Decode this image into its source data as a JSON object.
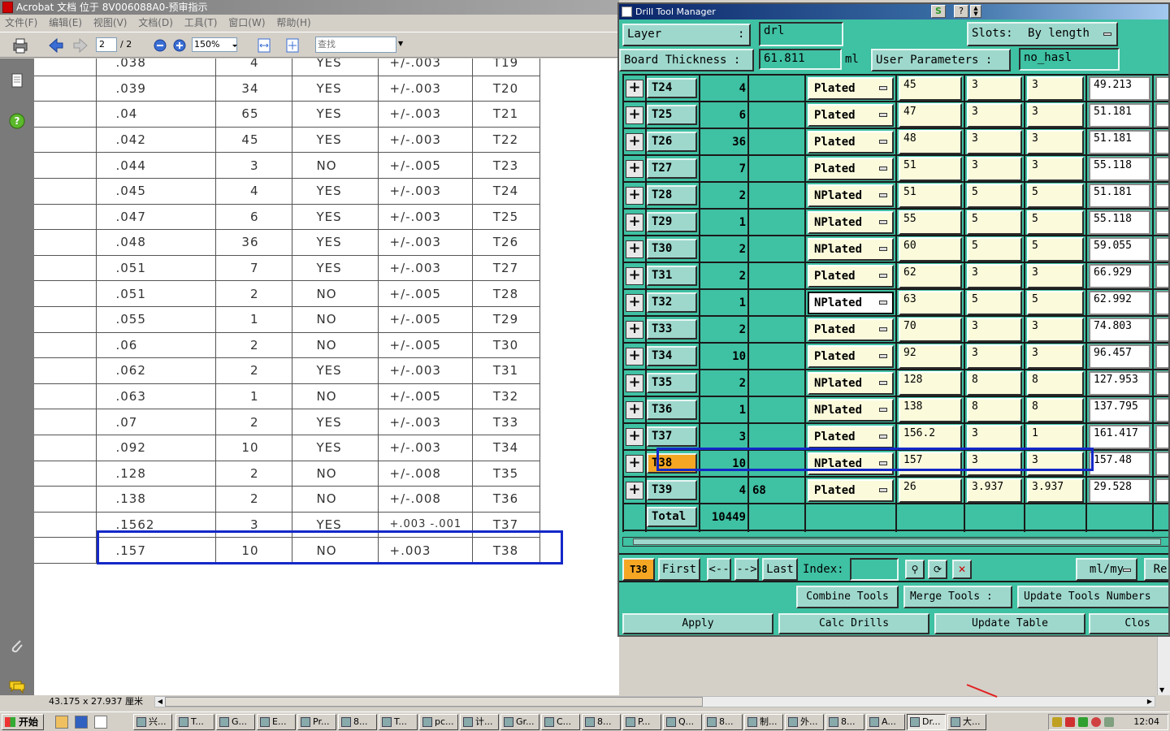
{
  "acrobat": {
    "title": "Acrobat 文档 位于 8V006088A0-预审指示",
    "menu": [
      "文件(F)",
      "编辑(E)",
      "视图(V)",
      "文档(D)",
      "工具(T)",
      "窗口(W)",
      "帮助(H)"
    ],
    "page_current": "2",
    "page_total": "/ 2",
    "zoom": "150%",
    "find_placeholder": "查找",
    "status_dimensions": "43.175 x 27.937 厘米",
    "table_rows": [
      {
        "size": ".038",
        "qty": "4",
        "plated": "YES",
        "tol": "+/-.003",
        "tool": "T19"
      },
      {
        "size": ".039",
        "qty": "34",
        "plated": "YES",
        "tol": "+/-.003",
        "tool": "T20"
      },
      {
        "size": ".04",
        "qty": "65",
        "plated": "YES",
        "tol": "+/-.003",
        "tool": "T21"
      },
      {
        "size": ".042",
        "qty": "45",
        "plated": "YES",
        "tol": "+/-.003",
        "tool": "T22"
      },
      {
        "size": ".044",
        "qty": "3",
        "plated": "NO",
        "tol": "+/-.005",
        "tool": "T23"
      },
      {
        "size": ".045",
        "qty": "4",
        "plated": "YES",
        "tol": "+/-.003",
        "tool": "T24"
      },
      {
        "size": ".047",
        "qty": "6",
        "plated": "YES",
        "tol": "+/-.003",
        "tool": "T25"
      },
      {
        "size": ".048",
        "qty": "36",
        "plated": "YES",
        "tol": "+/-.003",
        "tool": "T26"
      },
      {
        "size": ".051",
        "qty": "7",
        "plated": "YES",
        "tol": "+/-.003",
        "tool": "T27"
      },
      {
        "size": ".051",
        "qty": "2",
        "plated": "NO",
        "tol": "+/-.005",
        "tool": "T28"
      },
      {
        "size": ".055",
        "qty": "1",
        "plated": "NO",
        "tol": "+/-.005",
        "tool": "T29"
      },
      {
        "size": ".06",
        "qty": "2",
        "plated": "NO",
        "tol": "+/-.005",
        "tool": "T30"
      },
      {
        "size": ".062",
        "qty": "2",
        "plated": "YES",
        "tol": "+/-.003",
        "tool": "T31"
      },
      {
        "size": ".063",
        "qty": "1",
        "plated": "NO",
        "tol": "+/-.005",
        "tool": "T32"
      },
      {
        "size": ".07",
        "qty": "2",
        "plated": "YES",
        "tol": "+/-.003",
        "tool": "T33"
      },
      {
        "size": ".092",
        "qty": "10",
        "plated": "YES",
        "tol": "+/-.003",
        "tool": "T34"
      },
      {
        "size": ".128",
        "qty": "2",
        "plated": "NO",
        "tol": "+/-.008",
        "tool": "T35"
      },
      {
        "size": ".138",
        "qty": "2",
        "plated": "NO",
        "tol": "+/-.008",
        "tool": "T36"
      },
      {
        "size": ".1562",
        "qty": "3",
        "plated": "YES",
        "tol": "+.003 -.001",
        "tool": "T37"
      },
      {
        "size": ".157",
        "qty": "10",
        "plated": "NO",
        "tol": "+.003",
        "tool": "T38"
      }
    ]
  },
  "dtm": {
    "title": "Drill Tool Manager",
    "layer_label": "Layer",
    "layer_colon": ":",
    "layer_value": "drl",
    "slots_label": "Slots:",
    "slots_value": "By length",
    "board_thickness_label": "Board Thickness :",
    "board_thickness_value": "61.811",
    "board_thickness_unit": "ml",
    "user_params_label": "User Parameters :",
    "user_params_value": "no_hasl",
    "rows": [
      {
        "tool": "T24",
        "count": "4",
        "extra": "",
        "type": "Plated",
        "a": "45",
        "b": "3",
        "c": "3",
        "d": "49.213"
      },
      {
        "tool": "T25",
        "count": "6",
        "extra": "",
        "type": "Plated",
        "a": "47",
        "b": "3",
        "c": "3",
        "d": "51.181"
      },
      {
        "tool": "T26",
        "count": "36",
        "extra": "",
        "type": "Plated",
        "a": "48",
        "b": "3",
        "c": "3",
        "d": "51.181"
      },
      {
        "tool": "T27",
        "count": "7",
        "extra": "",
        "type": "Plated",
        "a": "51",
        "b": "3",
        "c": "3",
        "d": "55.118"
      },
      {
        "tool": "T28",
        "count": "2",
        "extra": "",
        "type": "NPlated",
        "a": "51",
        "b": "5",
        "c": "5",
        "d": "51.181"
      },
      {
        "tool": "T29",
        "count": "1",
        "extra": "",
        "type": "NPlated",
        "a": "55",
        "b": "5",
        "c": "5",
        "d": "55.118"
      },
      {
        "tool": "T30",
        "count": "2",
        "extra": "",
        "type": "NPlated",
        "a": "60",
        "b": "5",
        "c": "5",
        "d": "59.055"
      },
      {
        "tool": "T31",
        "count": "2",
        "extra": "",
        "type": "Plated",
        "a": "62",
        "b": "3",
        "c": "3",
        "d": "66.929"
      },
      {
        "tool": "T32",
        "count": "1",
        "extra": "",
        "type": "NPlated",
        "a": "63",
        "b": "5",
        "c": "5",
        "d": "62.992"
      },
      {
        "tool": "T33",
        "count": "2",
        "extra": "",
        "type": "Plated",
        "a": "70",
        "b": "3",
        "c": "3",
        "d": "74.803"
      },
      {
        "tool": "T34",
        "count": "10",
        "extra": "",
        "type": "Plated",
        "a": "92",
        "b": "3",
        "c": "3",
        "d": "96.457"
      },
      {
        "tool": "T35",
        "count": "2",
        "extra": "",
        "type": "NPlated",
        "a": "128",
        "b": "8",
        "c": "8",
        "d": "127.953"
      },
      {
        "tool": "T36",
        "count": "1",
        "extra": "",
        "type": "NPlated",
        "a": "138",
        "b": "8",
        "c": "8",
        "d": "137.795"
      },
      {
        "tool": "T37",
        "count": "3",
        "extra": "",
        "type": "Plated",
        "a": "156.2",
        "b": "3",
        "c": "1",
        "d": "161.417"
      },
      {
        "tool": "T38",
        "count": "10",
        "extra": "",
        "type": "NPlated",
        "a": "157",
        "b": "3",
        "c": "3",
        "d": "157.48"
      },
      {
        "tool": "T39",
        "count": "4",
        "extra": "68",
        "type": "Plated",
        "a": "26",
        "b": "3.937",
        "c": "3.937",
        "d": "29.528"
      }
    ],
    "total_label": "Total",
    "total_value": "10449",
    "nav": {
      "current": "T38",
      "first": "First",
      "prev": "<--",
      "next": "-->",
      "last": "Last",
      "index_label": "Index:",
      "units": "ml/my",
      "re": "Re"
    },
    "ops": {
      "combine": "Combine Tools",
      "merge": "Merge Tools :",
      "update_numbers": "Update Tools Numbers",
      "apply": "Apply",
      "calc": "Calc Drills",
      "update_table": "Update Table",
      "close": "Clos"
    }
  },
  "taskbar": {
    "start": "开始",
    "tasks": [
      "兴...",
      "T...",
      "G...",
      "E...",
      "Pr...",
      "8...",
      "T...",
      "pc...",
      "计...",
      "Gr...",
      "C...",
      "8...",
      "P...",
      "Q...",
      "8...",
      "制...",
      "外...",
      "8...",
      "A...",
      "Dr...",
      "大..."
    ],
    "clock": "12:04"
  }
}
